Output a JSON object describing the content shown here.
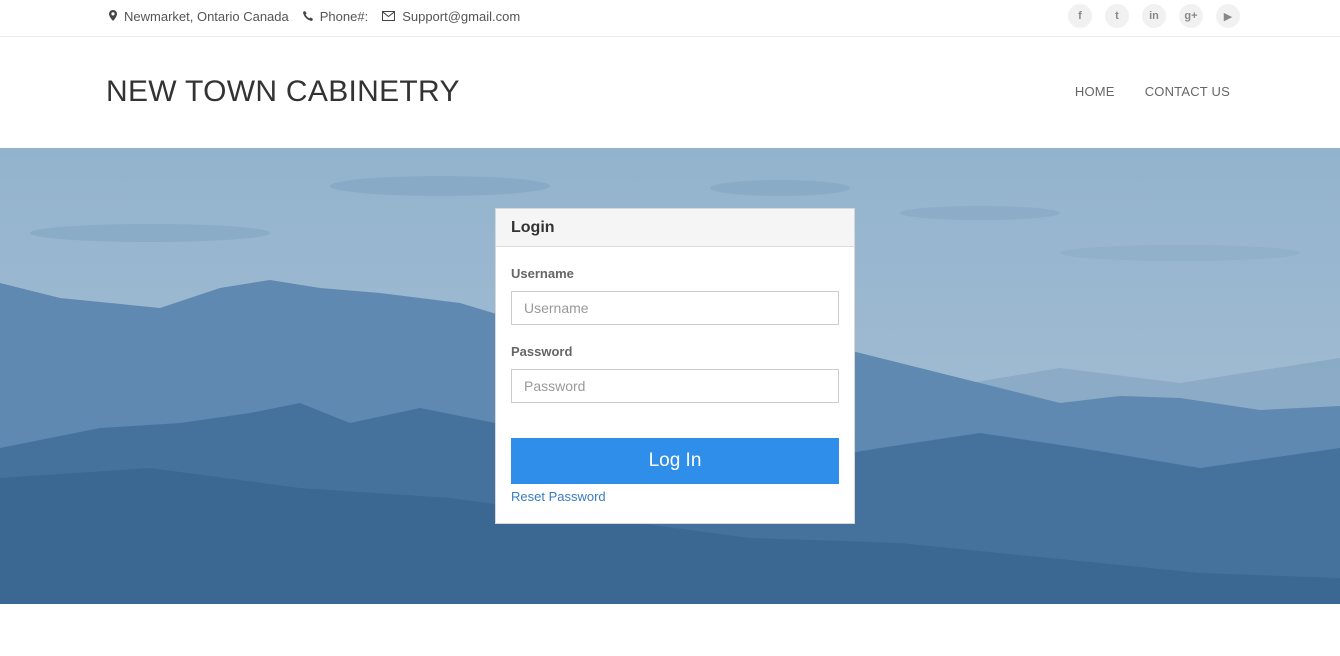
{
  "topbar": {
    "location": "Newmarket, Ontario Canada",
    "phone_label": "Phone#:",
    "email": "Support@gmail.com",
    "social": [
      {
        "icon": "facebook-icon",
        "glyph": "f"
      },
      {
        "icon": "twitter-icon",
        "glyph": "t"
      },
      {
        "icon": "linkedin-icon",
        "glyph": "in"
      },
      {
        "icon": "google-plus-icon",
        "glyph": "g+"
      },
      {
        "icon": "youtube-icon",
        "glyph": "▶"
      }
    ]
  },
  "header": {
    "brand": "NEW TOWN CABINETRY",
    "nav": {
      "home": "HOME",
      "contact": "CONTACT US"
    }
  },
  "login": {
    "title": "Login",
    "username_label": "Username",
    "username_placeholder": "Username",
    "username_value": "",
    "password_label": "Password",
    "password_placeholder": "Password",
    "password_value": "",
    "submit_label": "Log In",
    "reset_label": "Reset Password"
  },
  "colors": {
    "accent": "#2f8ee9",
    "link": "#3a7cc4",
    "hero_sky": "#8fb0cb",
    "hero_mountains": "#3f6d99"
  }
}
